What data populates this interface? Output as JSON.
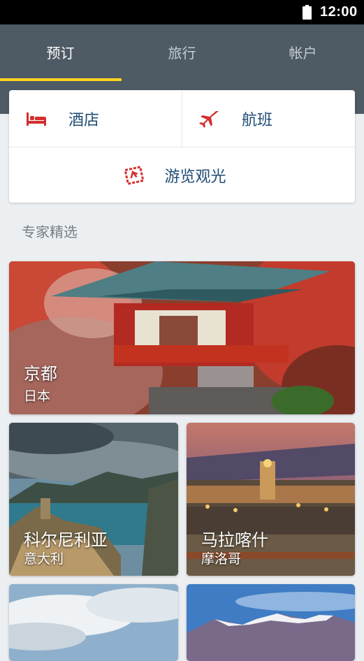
{
  "status_bar": {
    "time": "12:00"
  },
  "tabs": [
    {
      "label": "预订",
      "active": true
    },
    {
      "label": "旅行",
      "active": false
    },
    {
      "label": "帐户",
      "active": false
    }
  ],
  "booking": {
    "hotel_label": "酒店",
    "flight_label": "航班",
    "sightseeing_label": "游览观光"
  },
  "section_title": "专家精选",
  "destinations": [
    {
      "city": "京都",
      "country": "日本"
    },
    {
      "city": "科尔尼利亚",
      "country": "意大利"
    },
    {
      "city": "马拉喀什",
      "country": "摩洛哥"
    }
  ],
  "colors": {
    "header": "#4e5a64",
    "tab_indicator": "#ffd21f",
    "icon_red": "#d32f2f",
    "option_text": "#1f4b73"
  }
}
